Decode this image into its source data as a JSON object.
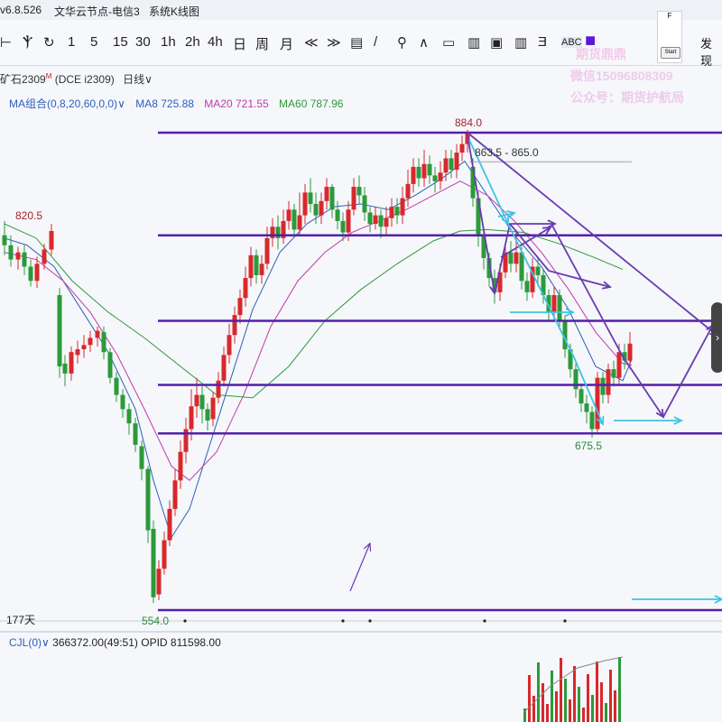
{
  "titlebar": {
    "version": "v6.8.526",
    "server": "文华云节点-电信3",
    "menu": "系统K线图"
  },
  "toolbar": {
    "items": [
      "⊢",
      "Ⲯ",
      "↻",
      "1",
      "5",
      "15",
      "30",
      "1h",
      "2h",
      "4h",
      "日",
      "周",
      "月",
      "≪",
      "≫",
      "▤",
      "/",
      "⚲",
      "∧",
      "▭",
      "▥",
      "▣",
      "▥",
      "Ǝ",
      "ABC",
      "■"
    ],
    "selected_index": 24,
    "discover_label": "发现",
    "start_label": "Start",
    "start_panel_text": "F"
  },
  "symbol": {
    "name": "矿石2309",
    "superscript": "M",
    "code": "(DCE i2309)",
    "period": "日线",
    "dropdown_glyph": "∨"
  },
  "indicators": {
    "group_label": "MA组合(0,8,20,60,0,0)",
    "dropdown_glyph": "∨",
    "ma8_label": "MA8",
    "ma8_value": "725.88",
    "ma20_label": "MA20",
    "ma20_value": "721.55",
    "ma60_label": "MA60",
    "ma60_value": "787.96",
    "ma8_color": "#2f5fb8",
    "ma20_color": "#c23aa8",
    "ma60_color": "#2f9a3a"
  },
  "watermark": {
    "line1": "期货鼎鼎",
    "line2": "微信15096808309",
    "line3": "公众号：期货护航局"
  },
  "days_label": "177天",
  "subchart": {
    "label": "CJL(0)",
    "dropdown_glyph": "∨",
    "values": "366372.00(49:51)",
    "opid": "OPID 811598.00"
  },
  "chart_data": {
    "type": "candlestick",
    "price_range": [
      540,
      900
    ],
    "price_labels": {
      "high_peak": "884.0",
      "resistance_range": "863.5 - 865.0",
      "left_high": "820.5",
      "recent_low": "675.5",
      "all_low": "554.0"
    },
    "horizontal_levels": [
      884,
      812,
      752,
      707,
      673,
      549
    ],
    "colors": {
      "up": "#d8282c",
      "down": "#2b9a3a",
      "level_line": "#5520a8",
      "arrow_purple": "#6a3ab0",
      "arrow_cyan": "#3fc4e6"
    }
  }
}
